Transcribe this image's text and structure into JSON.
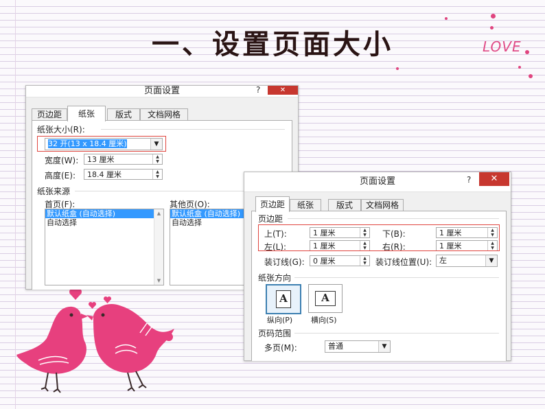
{
  "slide": {
    "title": "一、设置页面大小",
    "love_text": "LOVE"
  },
  "colors": {
    "accent_pink": "#e0457f",
    "highlight_red": "#e0453f",
    "selection_blue": "#3399ff",
    "close_red": "#c7372f"
  },
  "dialog_paper": {
    "title": "页面设置",
    "help": "?",
    "close": "✕",
    "tabs": [
      "页边距",
      "纸张",
      "版式",
      "文档网格"
    ],
    "active_tab": "纸张",
    "paper_size_label": "纸张大小(R):",
    "paper_size_value": "32 开(13 x 18.4 厘米)",
    "width_label": "宽度(W):",
    "width_value": "13 厘米",
    "height_label": "高度(E):",
    "height_value": "18.4 厘米",
    "paper_source_label": "纸张来源",
    "first_page_label": "首页(F):",
    "first_page_items": [
      "默认纸盒 (自动选择)",
      "自动选择"
    ],
    "other_pages_label": "其他页(O):",
    "other_pages_items": [
      "默认纸盒 (自动选择)",
      "自动选择"
    ]
  },
  "dialog_margins": {
    "title": "页面设置",
    "help": "?",
    "close": "✕",
    "tabs": [
      "页边距",
      "纸张",
      "版式",
      "文档网格"
    ],
    "active_tab": "页边距",
    "margins_label": "页边距",
    "top_label": "上(T):",
    "top_value": "1 厘米",
    "bottom_label": "下(B):",
    "bottom_value": "1 厘米",
    "left_label": "左(L):",
    "left_value": "1 厘米",
    "right_label": "右(R):",
    "right_value": "1 厘米",
    "gutter_label": "装订线(G):",
    "gutter_value": "0 厘米",
    "gutter_pos_label": "装订线位置(U):",
    "gutter_pos_value": "左",
    "orientation_label": "纸张方向",
    "portrait_label": "纵向(P)",
    "landscape_label": "横向(S)",
    "orientation_glyph": "A",
    "pages_section_label": "页码范围",
    "multiple_pages_label": "多页(M):",
    "multiple_pages_value": "普通"
  }
}
